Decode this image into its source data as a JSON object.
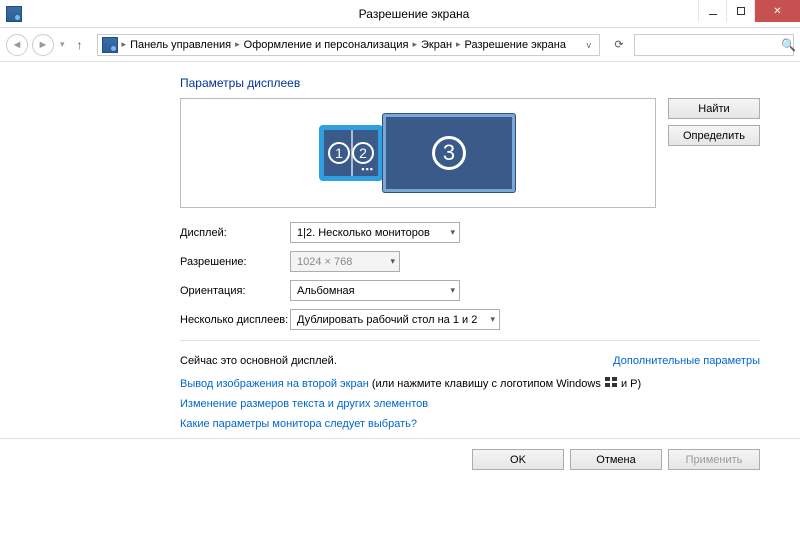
{
  "window": {
    "title": "Разрешение экрана"
  },
  "breadcrumbs": {
    "items": [
      "Панель управления",
      "Оформление и персонализация",
      "Экран",
      "Разрешение экрана"
    ]
  },
  "search": {
    "placeholder": ""
  },
  "heading": "Параметры дисплеев",
  "monitors": {
    "m12_label1": "1",
    "m12_label2": "2",
    "m3_label": "3"
  },
  "side_buttons": {
    "detect": "Найти",
    "identify": "Определить"
  },
  "fields": {
    "display_label": "Дисплей:",
    "display_value": "1|2. Несколько мониторов",
    "resolution_label": "Разрешение:",
    "resolution_value": "1024 × 768",
    "orientation_label": "Ориентация:",
    "orientation_value": "Альбомная",
    "multi_label": "Несколько дисплеев:",
    "multi_value": "Дублировать рабочий стол на 1 и 2"
  },
  "status": {
    "main_display": "Сейчас это основной дисплей.",
    "advanced_link": "Дополнительные параметры"
  },
  "links": {
    "project_prefix": "Вывод изображения на второй экран",
    "project_suffix": " (или нажмите клавишу с логотипом Windows ",
    "project_tail": " и P)",
    "text_size": "Изменение размеров текста и других элементов",
    "which_monitor": "Какие параметры монитора следует выбрать?"
  },
  "footer": {
    "ok": "OK",
    "cancel": "Отмена",
    "apply": "Применить"
  }
}
